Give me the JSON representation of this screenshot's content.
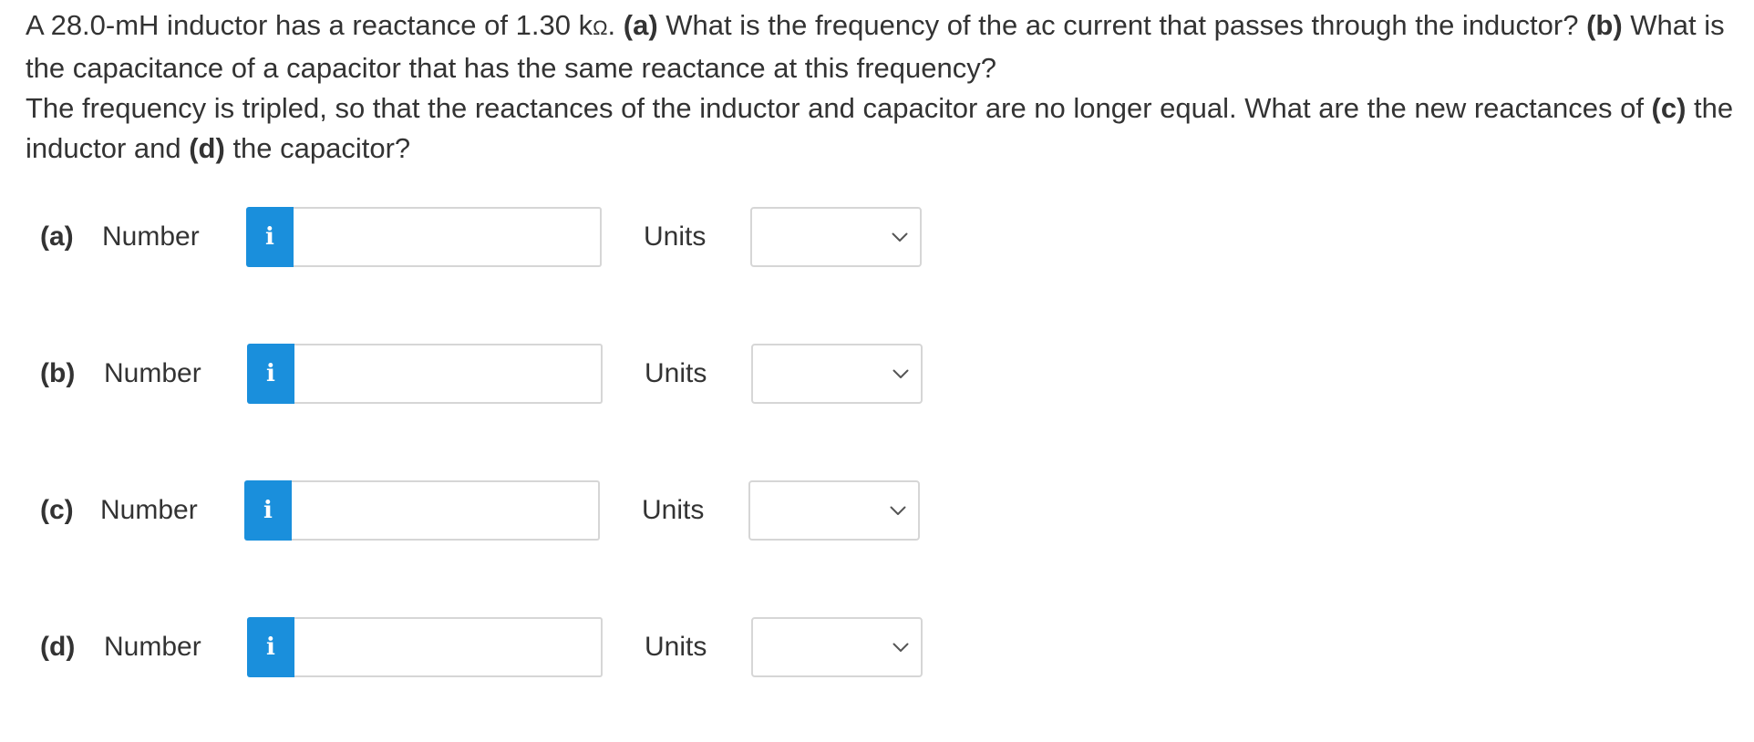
{
  "question": {
    "line1_pre": "A 28.0-mH inductor has a reactance of 1.30 k",
    "ohm_symbol": "Ω",
    "line1_after_unit": ". ",
    "part_a_marker": "(a)",
    "part_a_text": " What is the frequency of the ac current that passes through the inductor? ",
    "part_b_marker": "(b)",
    "part_b_text": " What is the capacitance of a capacitor that has the same reactance at this frequency?",
    "line2_pre": "The frequency is tripled, so that the reactances of the inductor and capacitor are no longer equal. What are the new reactances of ",
    "part_c_marker": "(c)",
    "line2_mid": " the inductor and ",
    "part_d_marker": "(d)",
    "line2_post": " the capacitor?"
  },
  "answers": [
    {
      "part": "(a)",
      "number_label": "Number",
      "info_icon": "i",
      "number_value": "",
      "units_label": "Units",
      "units_value": ""
    },
    {
      "part": "(b)",
      "number_label": "Number",
      "info_icon": "i",
      "number_value": "",
      "units_label": "Units",
      "units_value": ""
    },
    {
      "part": "(c)",
      "number_label": "Number",
      "info_icon": "i",
      "number_value": "",
      "units_label": "Units",
      "units_value": ""
    },
    {
      "part": "(d)",
      "number_label": "Number",
      "info_icon": "i",
      "number_value": "",
      "units_label": "Units",
      "units_value": ""
    }
  ],
  "icons": {
    "info": "info-icon",
    "dropdown": "chevron-down-icon"
  },
  "colors": {
    "info_button": "#1a8fdc",
    "text": "#333333",
    "border": "#d6d6d6"
  }
}
